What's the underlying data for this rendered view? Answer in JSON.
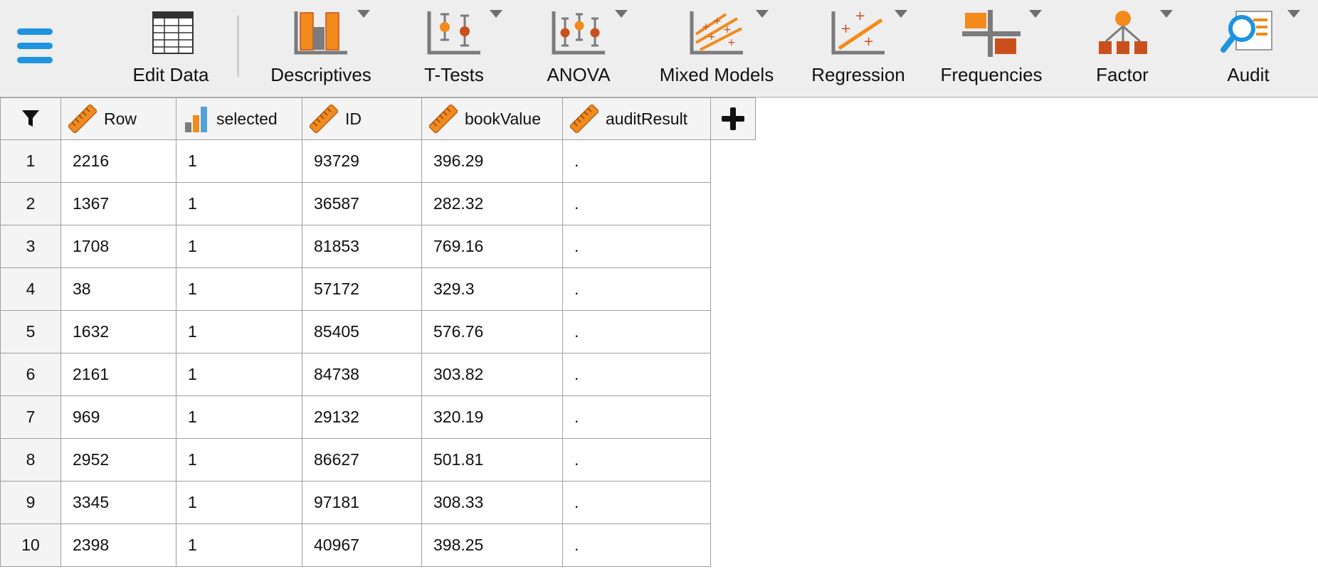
{
  "toolbar": {
    "edit_data_label": "Edit Data",
    "modules": [
      {
        "label": "Descriptives"
      },
      {
        "label": "T-Tests"
      },
      {
        "label": "ANOVA"
      },
      {
        "label": "Mixed Models"
      },
      {
        "label": "Regression"
      },
      {
        "label": "Frequencies"
      },
      {
        "label": "Factor"
      },
      {
        "label": "Audit"
      }
    ]
  },
  "grid": {
    "columns": [
      {
        "name": "Row",
        "type_icon": "scale-ruler-icon"
      },
      {
        "name": "selected",
        "type_icon": "ordinal-bars-icon"
      },
      {
        "name": "ID",
        "type_icon": "scale-ruler-icon"
      },
      {
        "name": "bookValue",
        "type_icon": "scale-ruler-icon"
      },
      {
        "name": "auditResult",
        "type_icon": "scale-ruler-icon"
      }
    ],
    "rows": [
      {
        "n": "1",
        "cells": [
          "2216",
          "1",
          "93729",
          "396.29",
          "."
        ]
      },
      {
        "n": "2",
        "cells": [
          "1367",
          "1",
          "36587",
          "282.32",
          "."
        ]
      },
      {
        "n": "3",
        "cells": [
          "1708",
          "1",
          "81853",
          "769.16",
          "."
        ]
      },
      {
        "n": "4",
        "cells": [
          "38",
          "1",
          "57172",
          "329.3",
          "."
        ]
      },
      {
        "n": "5",
        "cells": [
          "1632",
          "1",
          "85405",
          "576.76",
          "."
        ]
      },
      {
        "n": "6",
        "cells": [
          "2161",
          "1",
          "84738",
          "303.82",
          "."
        ]
      },
      {
        "n": "7",
        "cells": [
          "969",
          "1",
          "29132",
          "320.19",
          "."
        ]
      },
      {
        "n": "8",
        "cells": [
          "2952",
          "1",
          "86627",
          "501.81",
          "."
        ]
      },
      {
        "n": "9",
        "cells": [
          "3345",
          "1",
          "97181",
          "308.33",
          "."
        ]
      },
      {
        "n": "10",
        "cells": [
          "2398",
          "1",
          "40967",
          "398.25",
          "."
        ]
      }
    ]
  },
  "colors": {
    "accent_blue": "#1e93e0",
    "icon_orange": "#f28a1c",
    "icon_red": "#c9501c",
    "icon_gray": "#7b7b7b"
  }
}
